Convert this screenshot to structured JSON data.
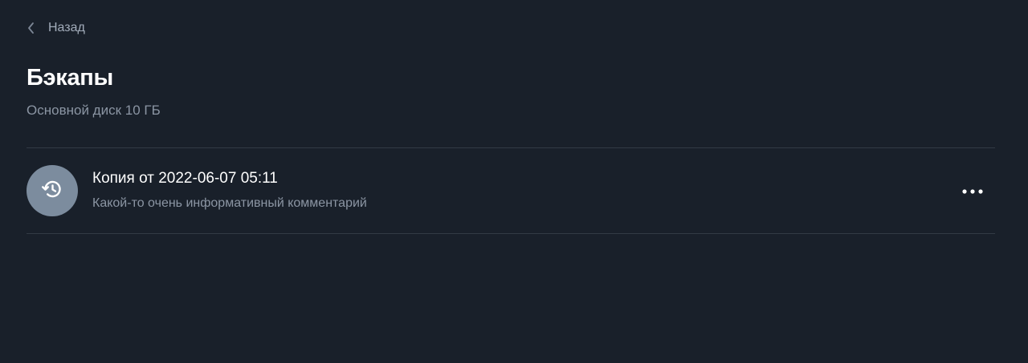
{
  "nav": {
    "back_label": "Назад",
    "back_icon": "chevron-left-icon"
  },
  "header": {
    "title": "Бэкапы",
    "subtitle": "Основной диск 10 ГБ"
  },
  "backups": [
    {
      "title": "Копия от 2022-06-07 05:11",
      "comment": "Какой-то очень информативный комментарий",
      "icon": "restore-history-icon",
      "menu_icon": "more-horizontal-icon"
    }
  ],
  "colors": {
    "background": "#19202a",
    "avatar": "#7c8c9e",
    "text_primary": "#ffffff",
    "text_secondary": "#8b95a3",
    "divider": "#323a45"
  }
}
